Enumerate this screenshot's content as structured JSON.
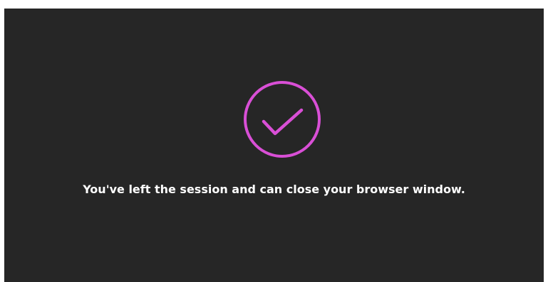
{
  "screen": {
    "background_color": "#262626",
    "accent_color": "#d94fd6",
    "icon": "checkmark-circle-icon",
    "message": "You've left the session and can close your browser window."
  }
}
